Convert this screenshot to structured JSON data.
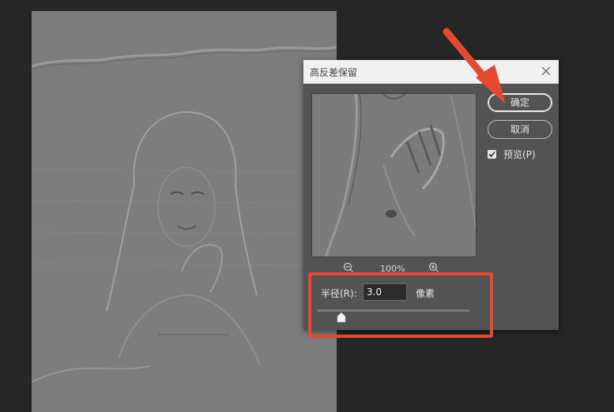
{
  "dialog": {
    "title": "高反差保留",
    "ok_label": "确定",
    "cancel_label": "取消",
    "preview_label": "预览(P)",
    "preview_checked": true,
    "zoom_level": "100%",
    "radius_label": "半径(R):",
    "radius_value": "3.0",
    "radius_unit": "像素"
  },
  "colors": {
    "workspace": "#262626",
    "dialog_bg": "#535353",
    "titlebar_bg": "#f0f0f0",
    "annotation_red": "#e44a32"
  },
  "icons": {
    "close": "close-icon",
    "zoom_out": "zoom-out-icon",
    "zoom_in": "zoom-in-icon",
    "check": "checkmark-icon",
    "annotation_arrow": "red-arrow-icon"
  }
}
